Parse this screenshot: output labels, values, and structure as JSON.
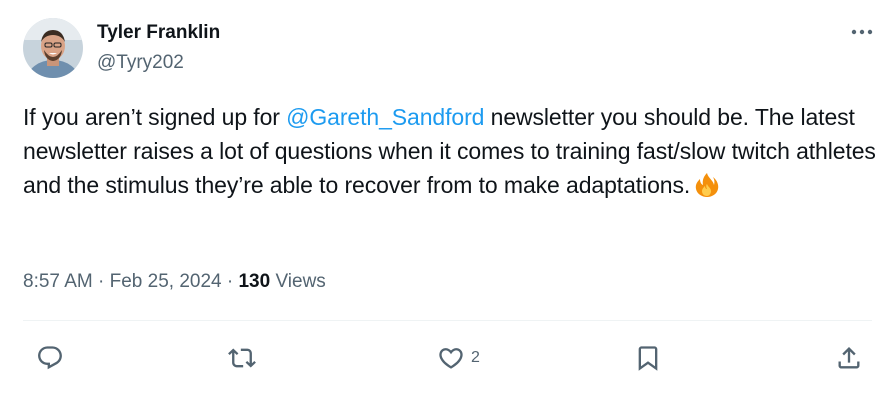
{
  "author": {
    "name": "Tyler Franklin",
    "handle": "@Tyry202"
  },
  "tweet": {
    "text_before": "If you aren’t signed up for ",
    "mention": "@Gareth_Sandford",
    "text_after": " newsletter you should be. The latest newsletter raises a lot of questions when it comes to training fast/slow twitch athletes and the stimulus they’re able to recover from to make adaptations.",
    "emoji_icon": "fire-icon"
  },
  "meta": {
    "time": "8:57 AM",
    "separator1": " · ",
    "date": "Feb 25, 2024",
    "separator2": " · ",
    "views_count": "130",
    "views_label": " Views"
  },
  "actions": {
    "reply_icon": "reply-icon",
    "retweet_icon": "retweet-icon",
    "like_icon": "heart-icon",
    "like_count": "2",
    "bookmark_icon": "bookmark-icon",
    "share_icon": "share-icon"
  },
  "colors": {
    "text": "#0f1419",
    "secondary": "#536471",
    "link": "#1d9bf0",
    "divider": "#eff3f4"
  }
}
